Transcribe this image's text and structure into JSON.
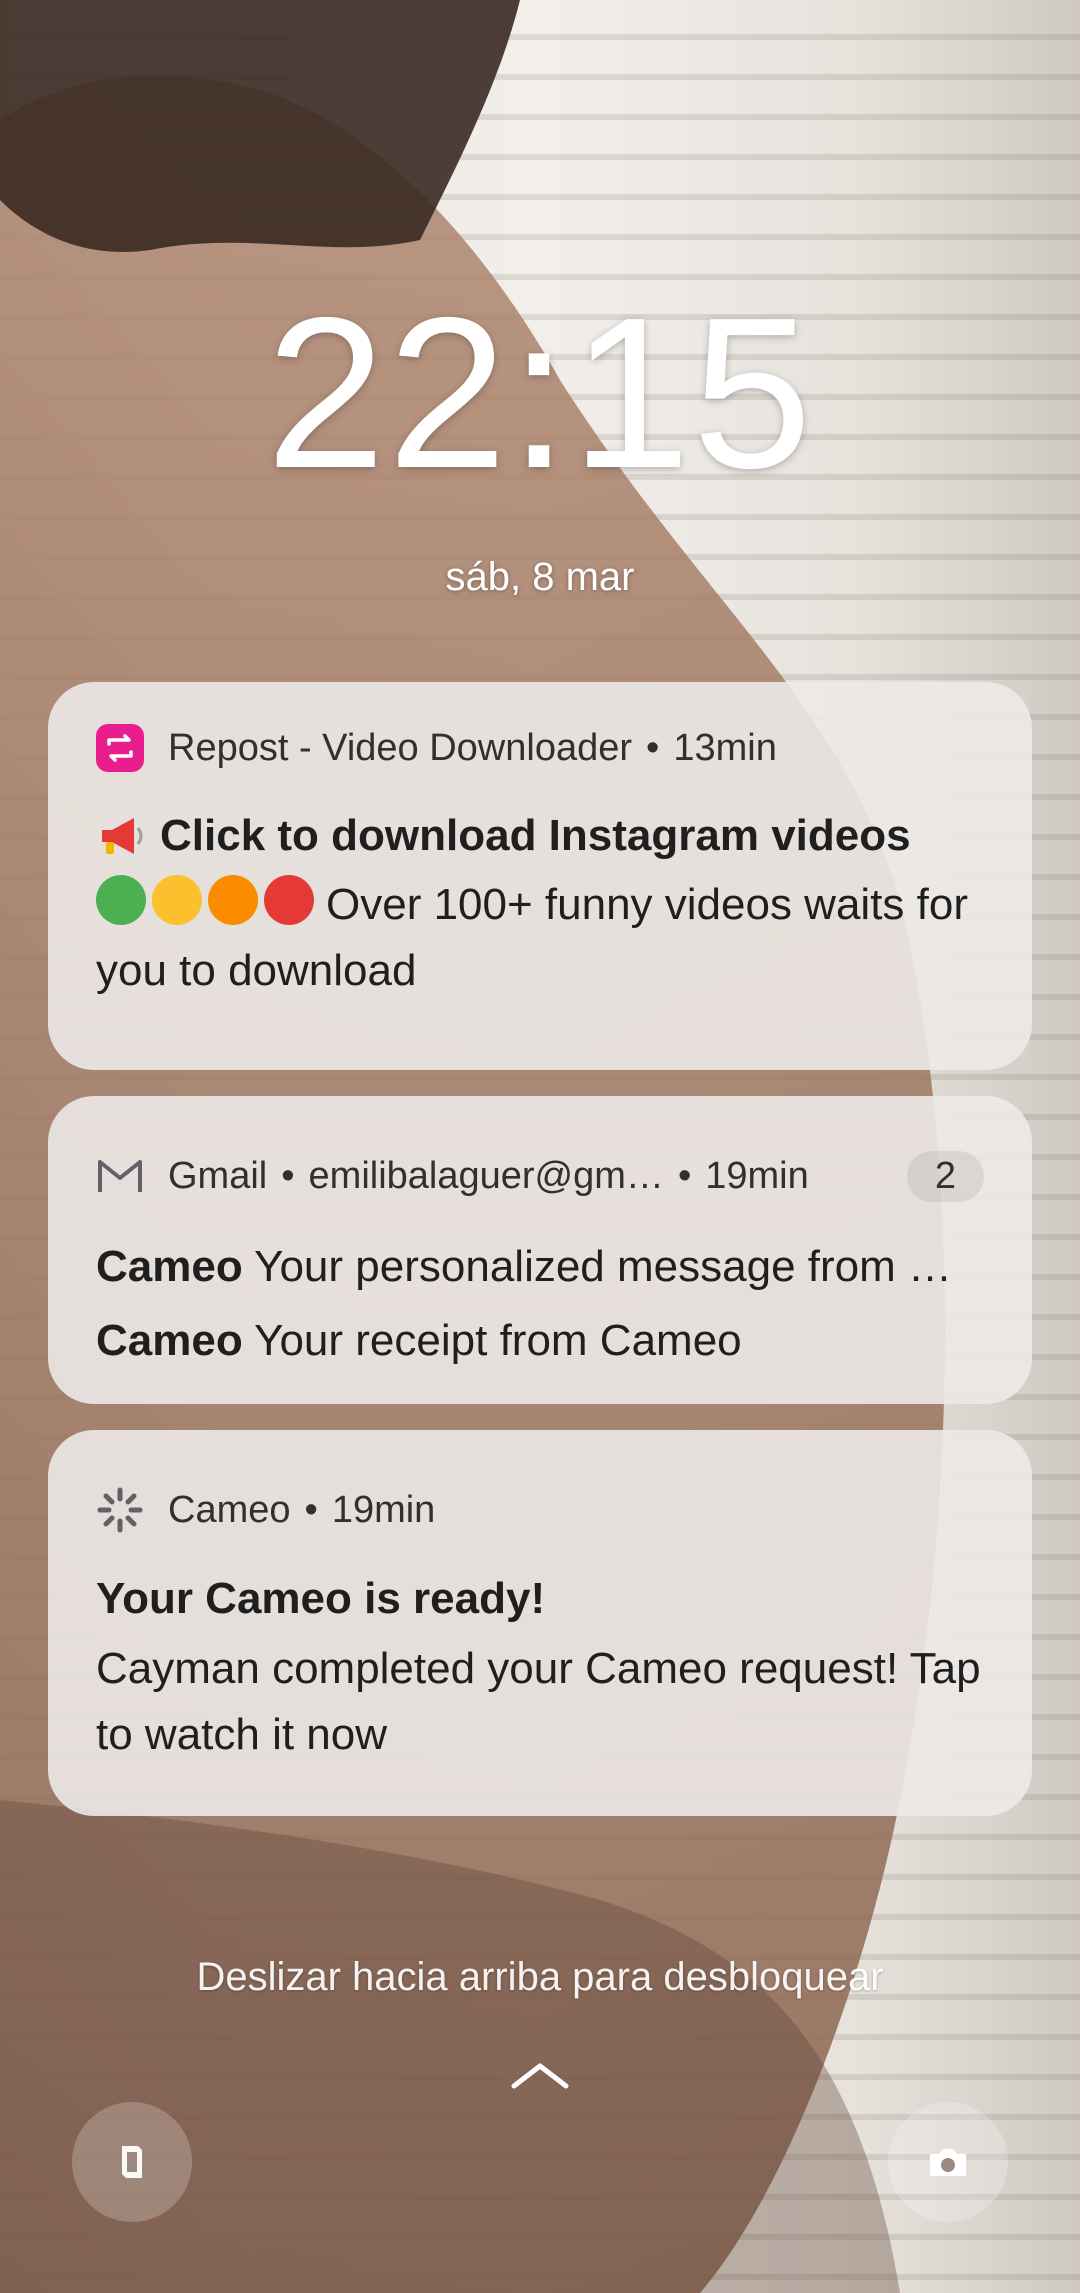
{
  "lockscreen": {
    "time": "22:15",
    "date": "sáb, 8 mar",
    "unlock_hint": "Deslizar hacia arriba para desbloquear"
  },
  "notifications": [
    {
      "app": "Repost - Video Downloader",
      "time": "13min",
      "icon": "repost-icon",
      "title": "Click to download Instagram videos",
      "title_icon": "megaphone-icon",
      "body": "Over 100+ funny videos waits for you to download",
      "emoji_colors": [
        "#4caf50",
        "#fbc02d",
        "#fb8c00",
        "#e53935"
      ],
      "accent": "#e91e8c"
    },
    {
      "app": "Gmail",
      "account": "emilibalaguer@gm…",
      "time": "19min",
      "count": "2",
      "icon": "gmail-icon",
      "messages": [
        {
          "sender": "Cameo",
          "subject": "Your personalized message from …"
        },
        {
          "sender": "Cameo",
          "subject": "Your receipt from Cameo"
        }
      ]
    },
    {
      "app": "Cameo",
      "time": "19min",
      "icon": "cameo-icon",
      "title": "Your Cameo is ready!",
      "body": "Cayman completed your Cameo request! Tap to watch it now"
    }
  ],
  "shortcuts": {
    "left": "phone-icon",
    "right": "camera-icon"
  }
}
